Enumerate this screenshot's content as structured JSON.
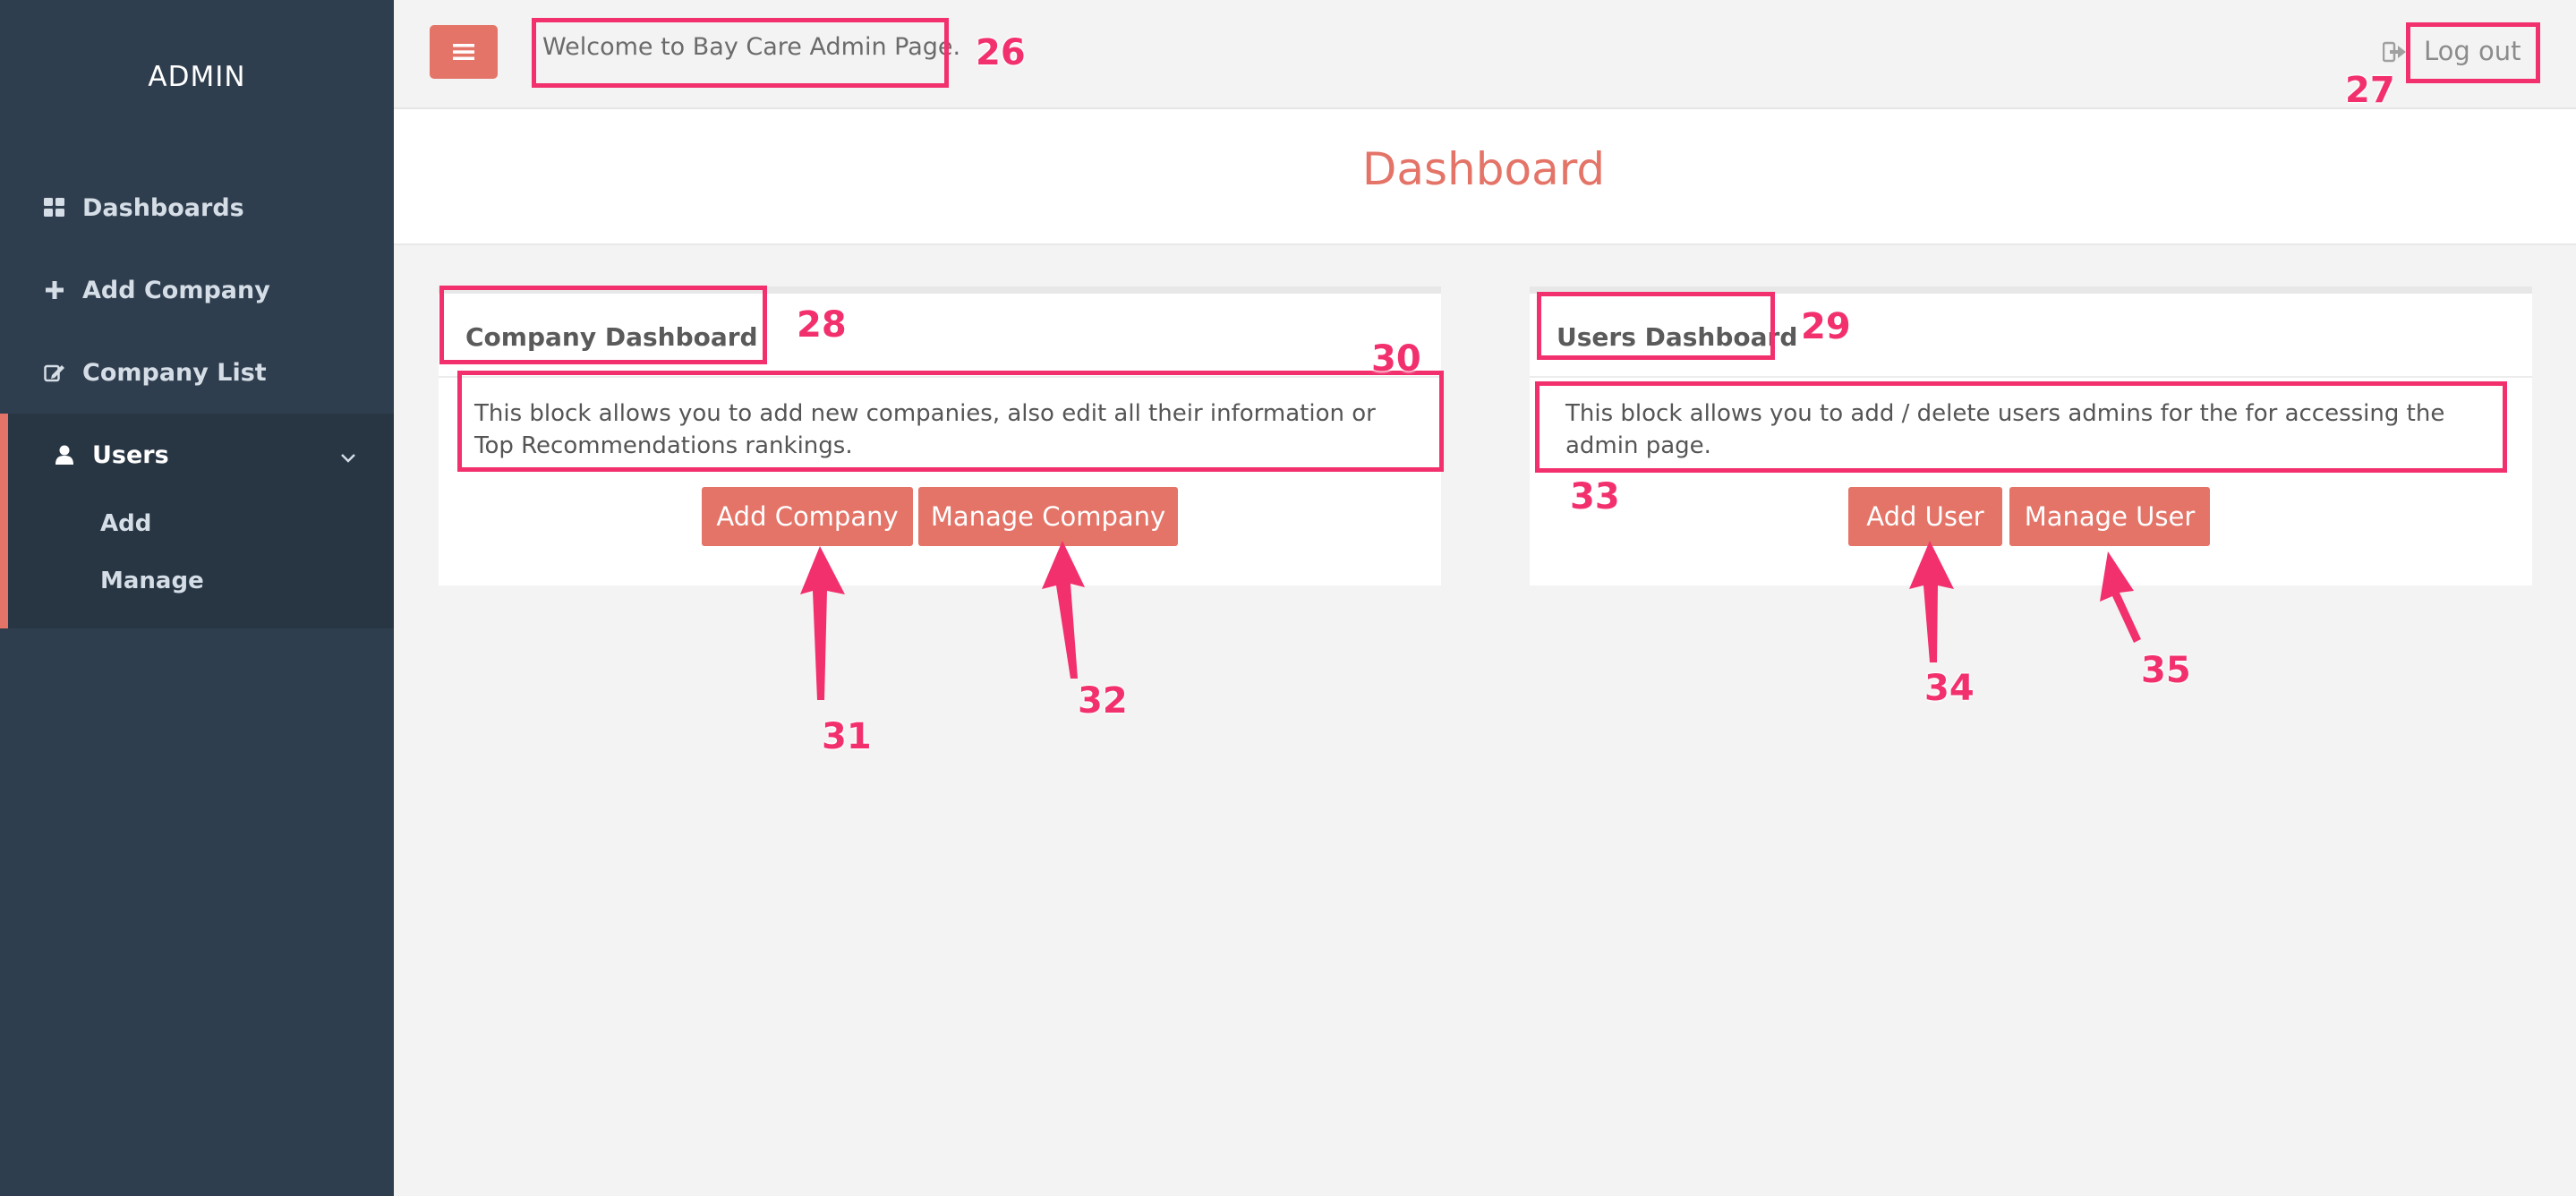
{
  "sidebar": {
    "brand": "ADMIN",
    "items": [
      {
        "label": "Dashboards",
        "icon": "grid-icon"
      },
      {
        "label": "Add Company",
        "icon": "plus-icon"
      },
      {
        "label": "Company List",
        "icon": "edit-icon"
      },
      {
        "label": "Users",
        "icon": "user-icon",
        "expanded": true
      }
    ],
    "subitems": [
      {
        "label": "Add"
      },
      {
        "label": "Manage"
      }
    ]
  },
  "topbar": {
    "welcome": "Welcome to Bay Care Admin Page.",
    "logout": "Log out"
  },
  "page": {
    "title": "Dashboard"
  },
  "panels": {
    "company": {
      "title": "Company Dashboard",
      "description": "This block allows you to add new companies, also edit all their information or Top Recommendations rankings.",
      "buttons": [
        "Add Company",
        "Manage Company"
      ]
    },
    "users": {
      "title": "Users Dashboard",
      "description": "This block allows you to add / delete users admins for the for accessing the admin page.",
      "buttons": [
        "Add User",
        "Manage User"
      ]
    }
  },
  "annotations": [
    "26",
    "27",
    "28",
    "29",
    "30",
    "31",
    "32",
    "33",
    "34",
    "35"
  ],
  "colors": {
    "sidebar": "#2f3e4e",
    "accent": "#e47468",
    "annotation": "#f2306e",
    "background": "#f3f3f3"
  }
}
